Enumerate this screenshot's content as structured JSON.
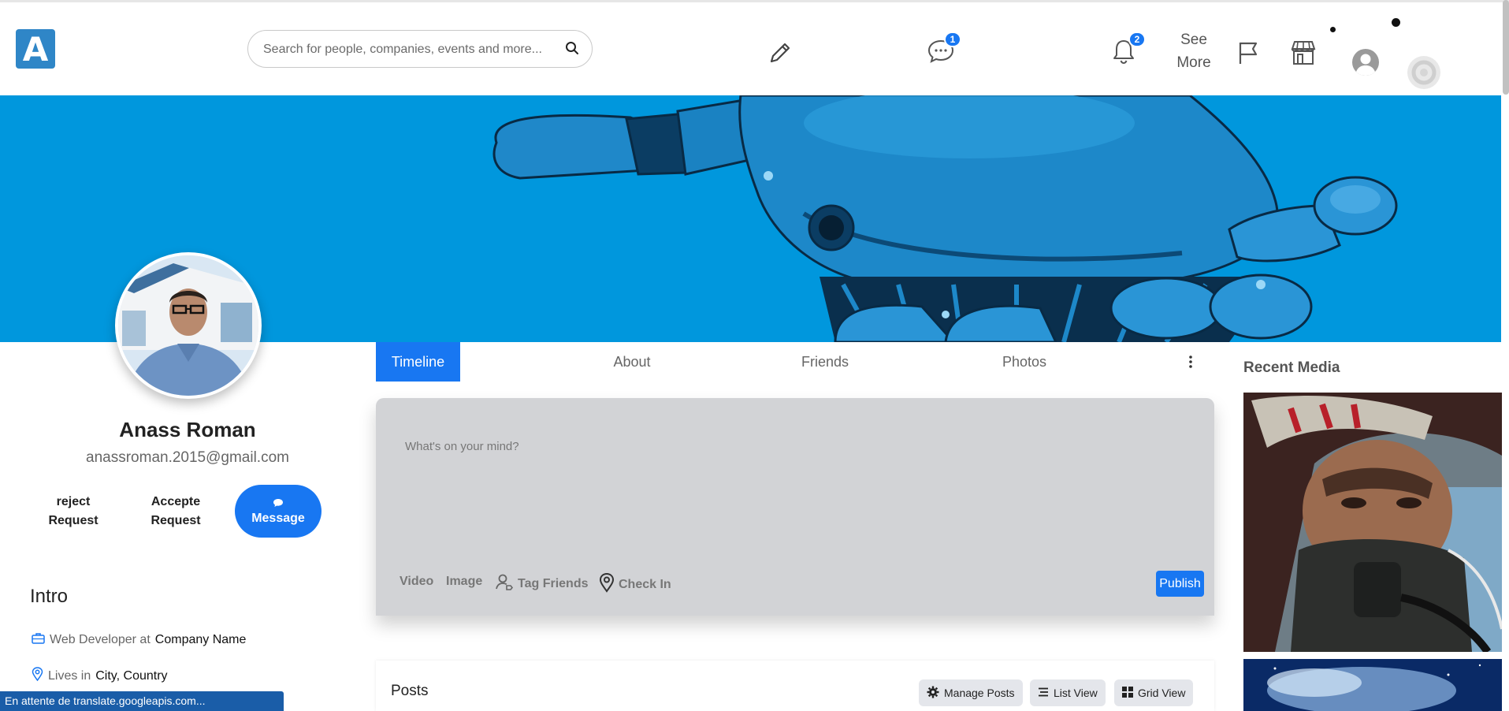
{
  "header": {
    "logo_letter": "A",
    "search_placeholder": "Search for people, companies, events and more...",
    "messages_badge": "1",
    "notifications_badge": "2",
    "see_more_line1": "See",
    "see_more_line2": "More"
  },
  "icons": [
    "search-icon",
    "pencil-icon",
    "chat-icon",
    "bell-icon",
    "flag-icon",
    "store-icon",
    "user-icon",
    "settings-icon"
  ],
  "profile": {
    "name": "Anass Roman",
    "email": "anassroman.2015@gmail.com",
    "reject_line1": "reject",
    "reject_line2": "Request",
    "accept_line1": "Accepte",
    "accept_line2": "Request",
    "message_label": "Message"
  },
  "intro": {
    "title": "Intro",
    "work_prefix": "Web Developer at",
    "work_company": "Company Name",
    "lives_prefix": "Lives in",
    "lives_place": "City, Country"
  },
  "tabs": [
    {
      "label": "Timeline",
      "active": true
    },
    {
      "label": "About"
    },
    {
      "label": "Friends"
    },
    {
      "label": "Photos"
    }
  ],
  "composer": {
    "placeholder": "What's on your mind?",
    "video": "Video",
    "image": "Image",
    "tag_friends": "Tag Friends",
    "check_in": "Check In",
    "publish": "Publish"
  },
  "posts": {
    "title": "Posts",
    "manage": "Manage Posts",
    "list_view": "List View",
    "grid_view": "Grid View"
  },
  "sidebar_right": {
    "recent_media_title": "Recent Media"
  },
  "status_bar": "En attente de translate.googleapis.com...",
  "colors": {
    "accent": "#1877f2",
    "cover": "#0097dd",
    "logo": "#2f86c7"
  }
}
